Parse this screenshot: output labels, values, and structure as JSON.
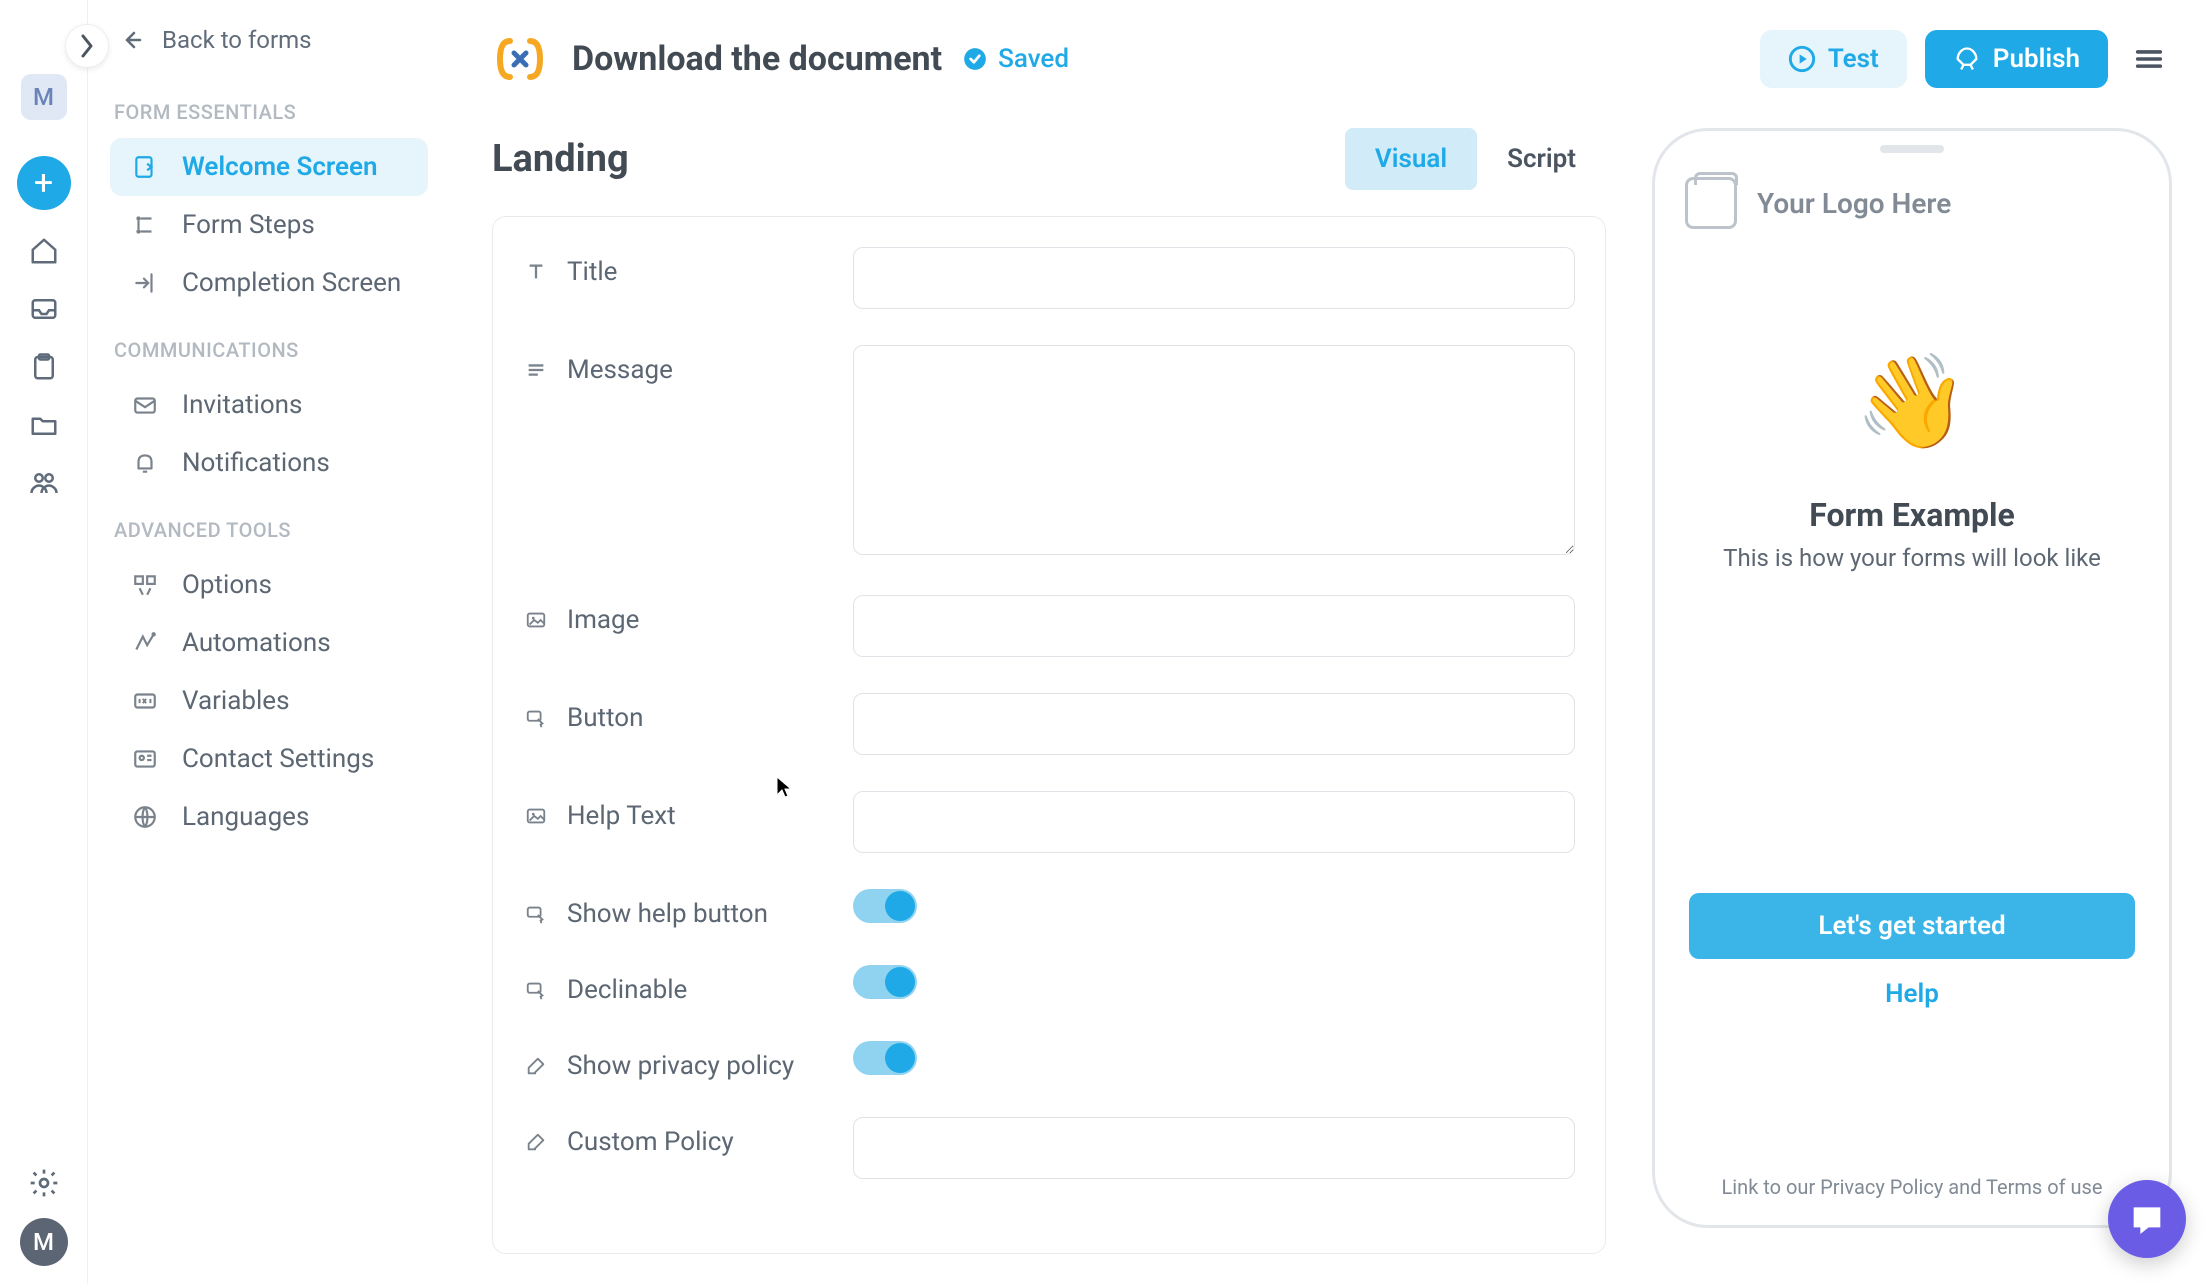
{
  "rail": {
    "avatar_letter": "M",
    "footer_avatar_letter": "M"
  },
  "back_link": "Back to forms",
  "sidebar": {
    "sections": [
      {
        "title": "FORM ESSENTIALS",
        "items": [
          "Welcome Screen",
          "Form Steps",
          "Completion Screen"
        ]
      },
      {
        "title": "COMMUNICATIONS",
        "items": [
          "Invitations",
          "Notifications"
        ]
      },
      {
        "title": "ADVANCED TOOLS",
        "items": [
          "Options",
          "Automations",
          "Variables",
          "Contact Settings",
          "Languages"
        ]
      }
    ]
  },
  "header": {
    "title": "Download the document",
    "saved_label": "Saved",
    "test_label": "Test",
    "publish_label": "Publish"
  },
  "editor": {
    "page_title": "Landing",
    "tabs": {
      "visual": "Visual",
      "script": "Script"
    },
    "fields": {
      "title": {
        "label": "Title",
        "value": ""
      },
      "message": {
        "label": "Message",
        "value": ""
      },
      "image": {
        "label": "Image",
        "value": ""
      },
      "button": {
        "label": "Button",
        "value": ""
      },
      "help_text": {
        "label": "Help Text",
        "value": ""
      },
      "show_help_button": {
        "label": "Show help button",
        "value": true
      },
      "declinable": {
        "label": "Declinable",
        "value": true
      },
      "show_privacy": {
        "label": "Show privacy policy",
        "value": true
      },
      "custom_policy": {
        "label": "Custom Policy",
        "value": ""
      }
    }
  },
  "preview": {
    "logo_text": "Your Logo Here",
    "title": "Form Example",
    "subtitle": "This is how your forms will look like",
    "button_label": "Let's get started",
    "help_label": "Help",
    "footer": "Link to our Privacy Policy and Terms of use"
  }
}
